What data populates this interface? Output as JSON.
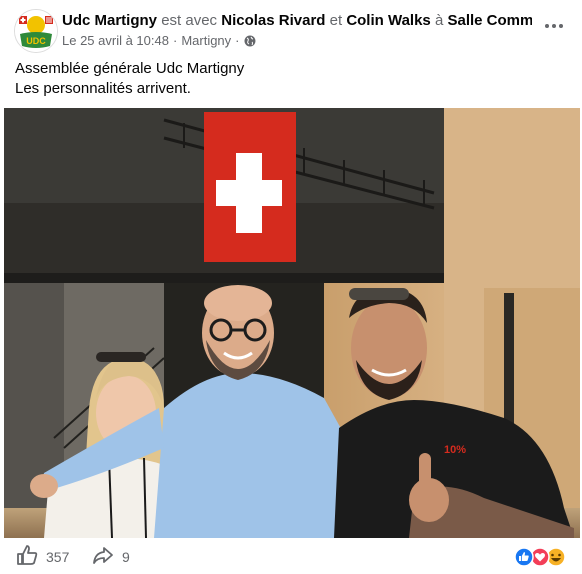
{
  "post": {
    "author": "Udc Martigny",
    "with_text": "est avec",
    "tag1": "Nicolas Rivard",
    "and_text": "et",
    "tag2": "Colin Walks",
    "at_text": "à",
    "place": "Salle Comm…",
    "date": "Le 25 avril à 10:48",
    "location": "Martigny",
    "separator": "·",
    "caption_lines": [
      "Assemblée générale Udc Martigny",
      "Les personnalités arrivent."
    ],
    "logo_text": "UDC",
    "flag_banner": "10%"
  },
  "icons": {
    "privacy": "globe-icon",
    "more": "more-dots-icon",
    "like": "like-thumb-icon",
    "share": "share-arrow-icon",
    "reactions": [
      "like-reaction-icon",
      "love-reaction-icon",
      "haha-reaction-icon"
    ]
  },
  "stats": {
    "likes": "357",
    "shares": "9"
  },
  "colors": {
    "brand_green": "#2f8a3a",
    "brand_yellow": "#f2c200",
    "swiss_red": "#d52b1e",
    "fb_blue": "#1877f2",
    "love_red": "#f33e58",
    "haha_yellow": "#f7b125"
  }
}
